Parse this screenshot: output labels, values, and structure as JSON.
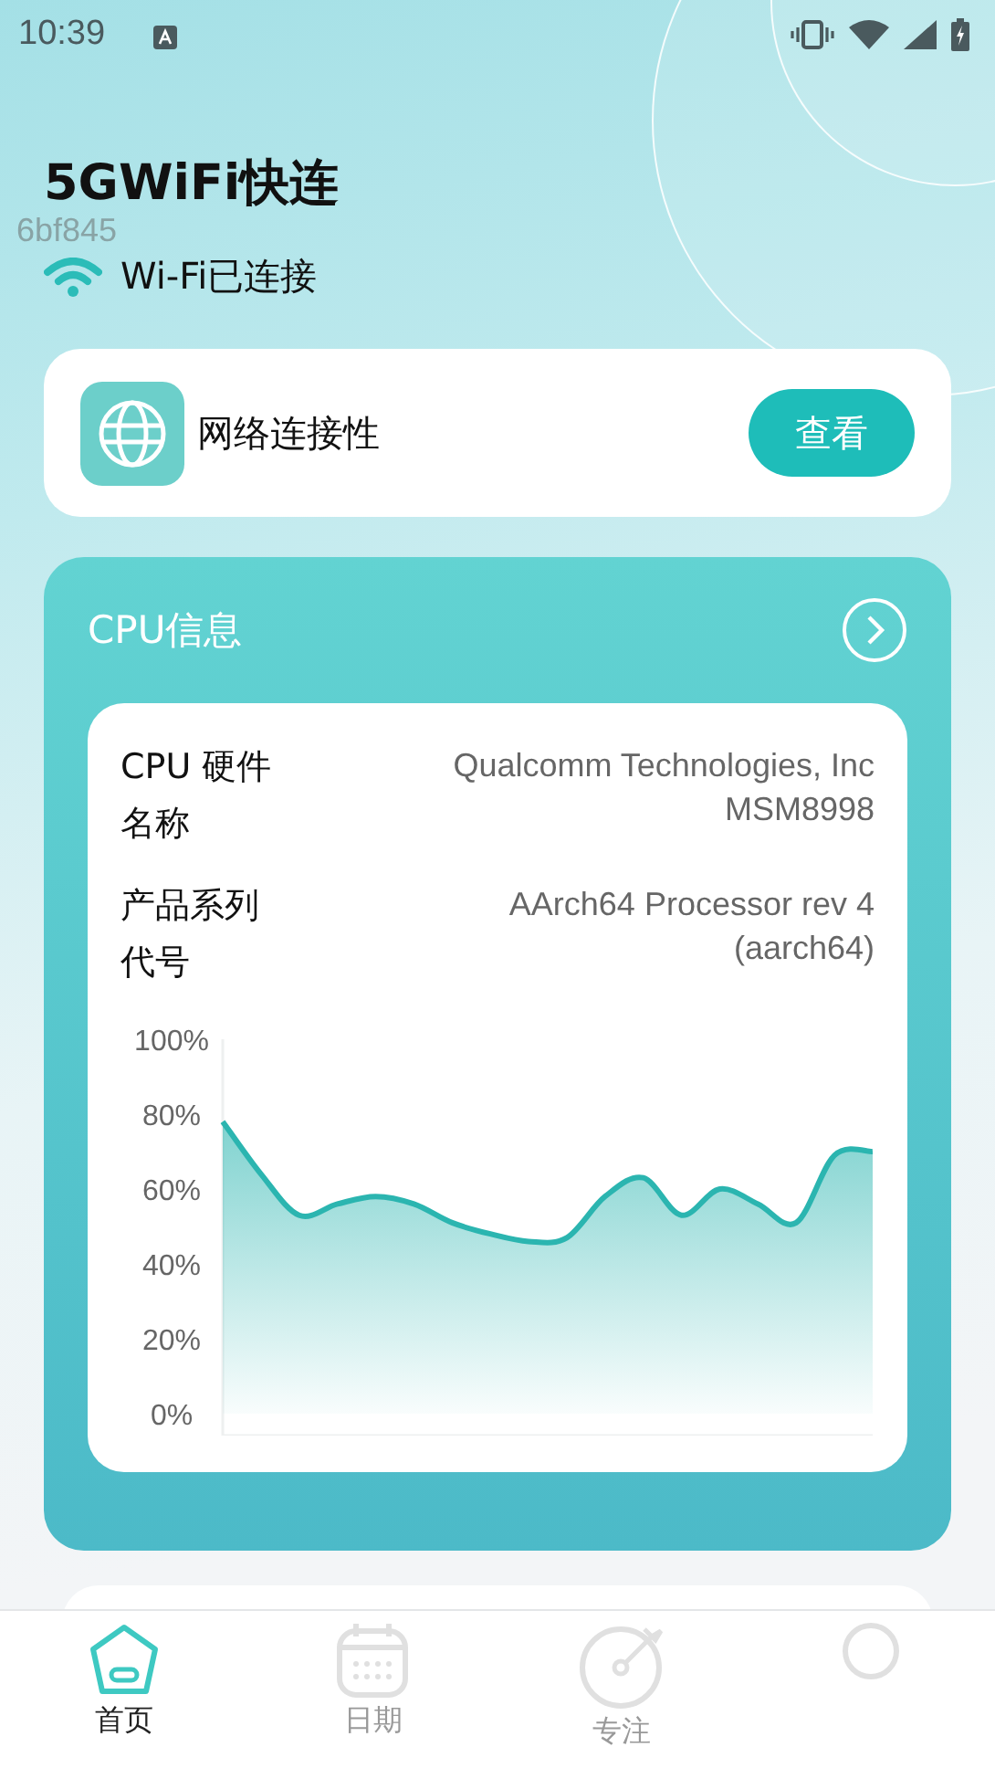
{
  "status_bar": {
    "time": "10:39"
  },
  "header": {
    "title": "5GWiFi快连",
    "overlay_text": "6bf845",
    "wifi_status": "Wi-Fi已连接"
  },
  "connectivity_card": {
    "label": "网络连接性",
    "button": "查看"
  },
  "cpu_card": {
    "title": "CPU信息",
    "rows": [
      {
        "label": "CPU 硬件名称",
        "value": "Qualcomm Technologies, Inc MSM8998"
      },
      {
        "label": "产品系列代号",
        "value": "AArch64 Processor rev 4 (aarch64)"
      }
    ],
    "chart_data": {
      "type": "area",
      "series": [
        {
          "color": "#2bb5b0",
          "values": [
            78,
            64,
            53,
            56,
            58,
            56,
            51,
            48,
            46,
            47,
            58,
            63,
            53,
            60,
            56,
            51,
            69,
            70
          ]
        }
      ],
      "ylim": [
        0,
        100
      ],
      "yticks": [
        {
          "value": 0,
          "label": "0%"
        },
        {
          "value": 20,
          "label": "20%"
        },
        {
          "value": 40,
          "label": "40%"
        },
        {
          "value": 60,
          "label": "60%"
        },
        {
          "value": 80,
          "label": "80%"
        },
        {
          "value": 100,
          "label": "100%"
        }
      ]
    }
  },
  "tab_bar": [
    {
      "kind": "home",
      "label": "首页",
      "selected": true
    },
    {
      "kind": "calendar",
      "label": "日期",
      "selected": false
    },
    {
      "kind": "focus",
      "label": "专注",
      "selected": false
    },
    {
      "kind": "profile",
      "selected": false
    }
  ]
}
